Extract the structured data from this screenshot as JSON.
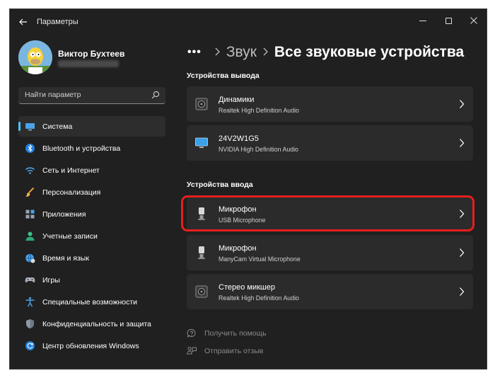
{
  "window": {
    "title": "Параметры"
  },
  "profile": {
    "name": "Виктор Бухтеев"
  },
  "search": {
    "placeholder": "Найти параметр"
  },
  "sidebar": {
    "items": [
      {
        "label": "Система",
        "icon": "monitor-icon",
        "active": true
      },
      {
        "label": "Bluetooth и устройства",
        "icon": "bluetooth-icon"
      },
      {
        "label": "Сеть и Интернет",
        "icon": "wifi-icon"
      },
      {
        "label": "Персонализация",
        "icon": "brush-icon"
      },
      {
        "label": "Приложения",
        "icon": "apps-icon"
      },
      {
        "label": "Учетные записи",
        "icon": "person-icon"
      },
      {
        "label": "Время и язык",
        "icon": "globe-clock-icon"
      },
      {
        "label": "Игры",
        "icon": "gamepad-icon"
      },
      {
        "label": "Специальные возможности",
        "icon": "accessibility-icon"
      },
      {
        "label": "Конфиденциальность и защита",
        "icon": "shield-icon"
      },
      {
        "label": "Центр обновления Windows",
        "icon": "update-icon"
      }
    ]
  },
  "breadcrumb": {
    "dots": "•••",
    "parent": "Звук",
    "current": "Все звуковые устройства"
  },
  "output": {
    "title": "Устройства вывода",
    "devices": [
      {
        "name": "Динамики",
        "driver": "Realtek High Definition Audio",
        "icon": "speaker-icon"
      },
      {
        "name": "24V2W1G5",
        "driver": "NVIDIA High Definition Audio",
        "icon": "monitor-icon"
      }
    ]
  },
  "input": {
    "title": "Устройства ввода",
    "devices": [
      {
        "name": "Микрофон",
        "driver": "USB Microphone",
        "icon": "microphone-icon",
        "highlighted": true
      },
      {
        "name": "Микрофон",
        "driver": "ManyCam Virtual Microphone",
        "icon": "microphone-icon"
      },
      {
        "name": "Стерео микшер",
        "driver": "Realtek High Definition Audio",
        "icon": "speaker-icon"
      }
    ]
  },
  "footer": {
    "help": "Получить помощь",
    "feedback": "Отправить отзыв"
  },
  "colors": {
    "accent": "#4cc2ff",
    "background": "#202020",
    "card": "#2b2b2b",
    "highlight": "#e51f1f"
  }
}
